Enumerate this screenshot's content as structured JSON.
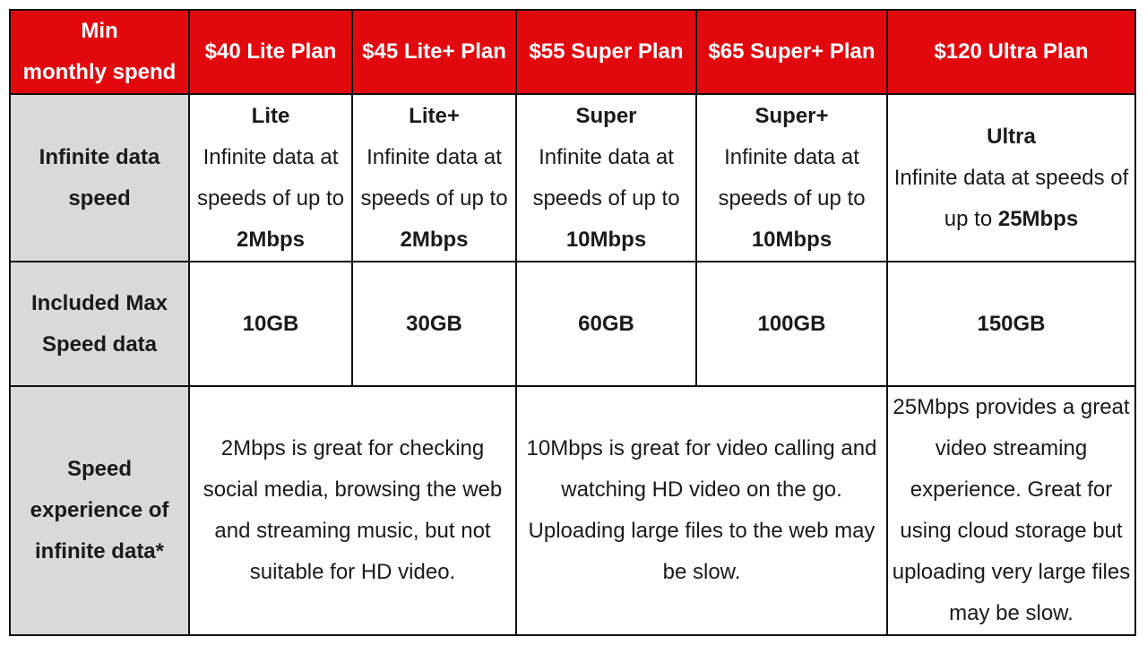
{
  "header": {
    "corner": [
      "Min",
      "monthly spend"
    ],
    "plans": [
      "$40 Lite Plan",
      "$45 Lite+ Plan",
      "$55 Super Plan",
      "$65 Super+ Plan",
      "$120 Ultra Plan"
    ]
  },
  "rows": {
    "speed": {
      "label": [
        "Infinite data",
        "speed"
      ],
      "cells": [
        {
          "name": "Lite",
          "pre": "Infinite data at speeds of up to ",
          "value": "2Mbps"
        },
        {
          "name": "Lite+",
          "pre": "Infinite data at speeds of up to ",
          "value": "2Mbps"
        },
        {
          "name": "Super",
          "pre": "Infinite data at speeds of up to ",
          "value": "10Mbps"
        },
        {
          "name": "Super+",
          "pre": "Infinite data at speeds of up to ",
          "value": "10Mbps"
        },
        {
          "name": "Ultra",
          "pre": "Infinite data at speeds of up to ",
          "value": "25Mbps"
        }
      ]
    },
    "maxdata": {
      "label": [
        "Included Max",
        "Speed data"
      ],
      "cells": [
        "10GB",
        "30GB",
        "60GB",
        "100GB",
        "150GB"
      ]
    },
    "experience": {
      "label": [
        "Speed",
        "experience of",
        "infinite data*"
      ],
      "cells": [
        "2Mbps is great for checking social media, browsing the web and streaming music, but not suitable for HD video.",
        "10Mbps is great for video calling and watching HD video on the go. Uploading large files to the web may be slow.",
        "25Mbps provides a great video streaming experience. Great for using cloud storage but uploading very large files may be slow."
      ]
    }
  }
}
